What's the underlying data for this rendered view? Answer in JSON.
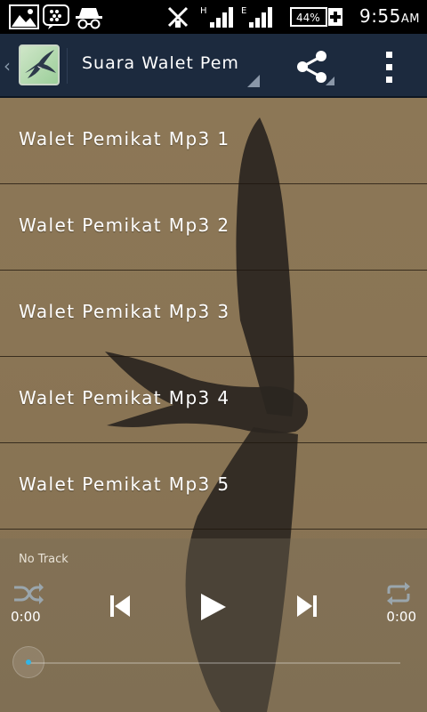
{
  "status_bar": {
    "battery": "44%",
    "time": "9:55",
    "ampm": "AM",
    "network_1": "H",
    "network_2": "E"
  },
  "action_bar": {
    "title": "Suara Walet Pemikat"
  },
  "tracks": [
    {
      "label": "Walet Pemikat Mp3 1"
    },
    {
      "label": "Walet Pemikat Mp3 2"
    },
    {
      "label": "Walet Pemikat Mp3 3"
    },
    {
      "label": "Walet Pemikat Mp3 4"
    },
    {
      "label": "Walet Pemikat Mp3 5"
    }
  ],
  "player": {
    "now_playing": "No Track",
    "elapsed": "0:00",
    "duration": "0:00",
    "progress": 0,
    "icons": {
      "shuffle": "shuffle-icon",
      "previous": "skip-previous-icon",
      "play": "play-icon",
      "next": "skip-next-icon",
      "repeat": "repeat-icon"
    }
  },
  "colors": {
    "action_bar": "#1c2a3e",
    "background": "#8a7555",
    "accent": "#33b5e5"
  }
}
